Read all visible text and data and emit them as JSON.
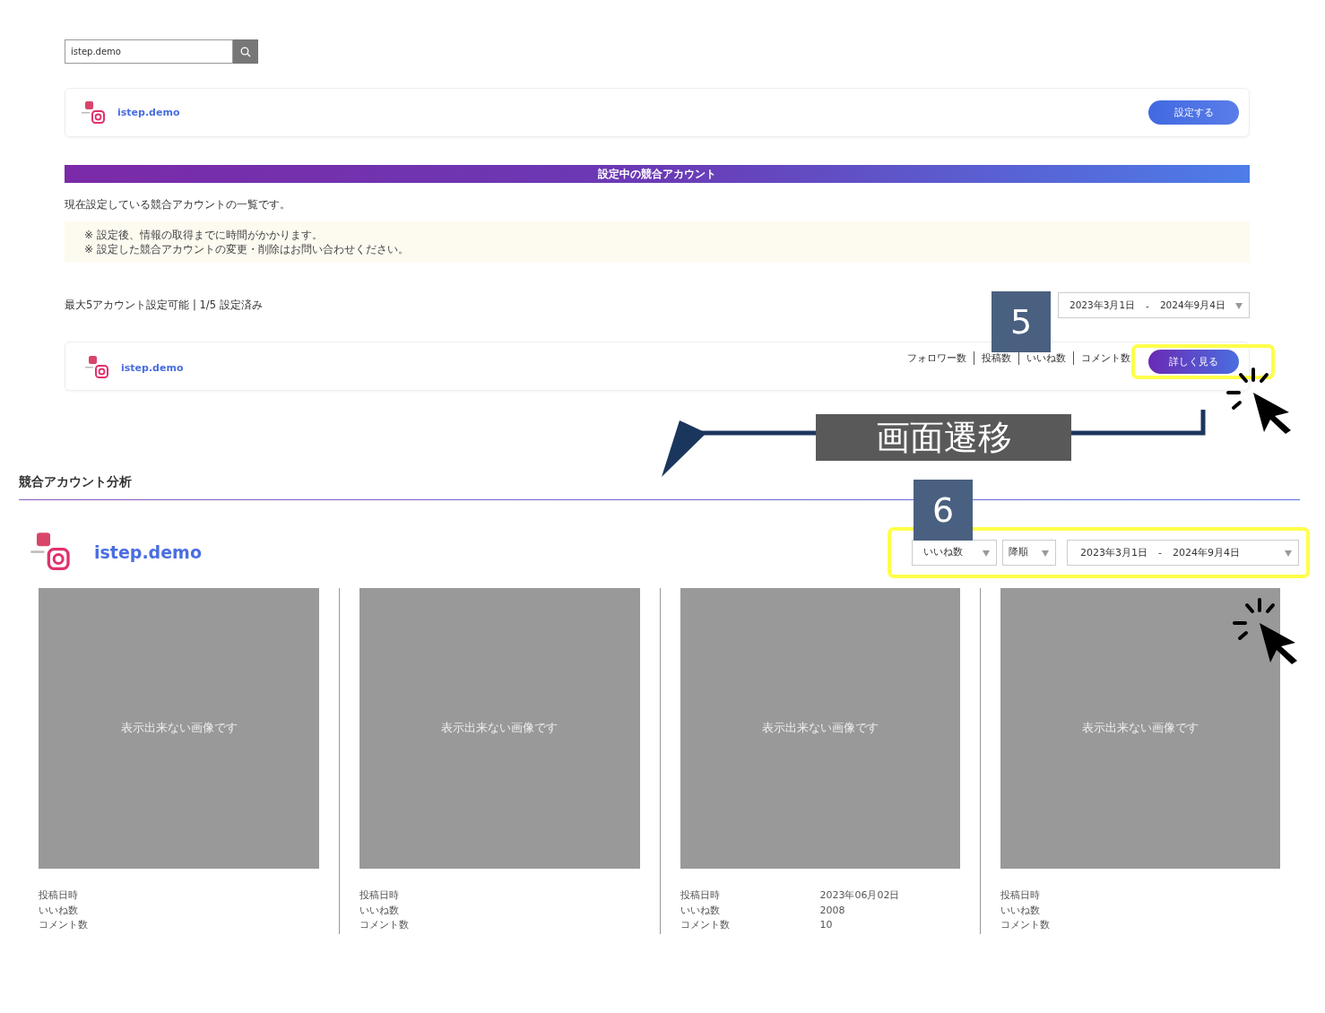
{
  "search": {
    "value": "istep.demo"
  },
  "candidate": {
    "name": "istep.demo",
    "button": "設定する"
  },
  "banner": "設定中の競合アカウント",
  "description": "現在設定している競合アカウントの一覧です。",
  "notes": [
    "※ 設定後、情報の取得までに時間がかかります。",
    "※ 設定した競合アカウントの変更・削除はお問い合わせください。"
  ],
  "limit_text": "最大5アカウント設定可能 | 1/5 設定済み",
  "date_range": {
    "start": "2023年3月1日",
    "separator": "-",
    "end": "2024年9月4日"
  },
  "account": {
    "name": "istep.demo",
    "stats": [
      "フォロワー数",
      "投稿数",
      "いいね数",
      "コメント数"
    ],
    "button": "詳しく見る"
  },
  "annotations": [
    {
      "number": "5"
    },
    {
      "number": "6"
    }
  ],
  "transition_label": "画面遷移",
  "analysis": {
    "title": "競合アカウント分析",
    "account": "istep.demo",
    "sort_field": "いいね数",
    "sort_order": "降順",
    "date_range": {
      "start": "2023年3月1日",
      "separator": "-",
      "end": "2024年9月4日"
    }
  },
  "posts": [
    {
      "image_text": "表示出来ない画像です",
      "rows": [
        {
          "label": "投稿日時"
        },
        {
          "label": "いいね数"
        },
        {
          "label": "コメント数"
        }
      ]
    },
    {
      "image_text": "表示出来ない画像です",
      "rows": [
        {
          "label": "投稿日時"
        },
        {
          "label": "いいね数"
        },
        {
          "label": "コメント数"
        }
      ]
    },
    {
      "image_text": "表示出来ない画像です",
      "rows": [
        {
          "label": "投稿日時",
          "value": "2023年06月02日"
        },
        {
          "label": "いいね数",
          "value": "2008"
        },
        {
          "label": "コメント数",
          "value": "10"
        }
      ]
    },
    {
      "image_text": "表示出来ない画像です",
      "rows": [
        {
          "label": "投稿日時"
        },
        {
          "label": "いいね数"
        },
        {
          "label": "コメント数"
        }
      ]
    }
  ]
}
